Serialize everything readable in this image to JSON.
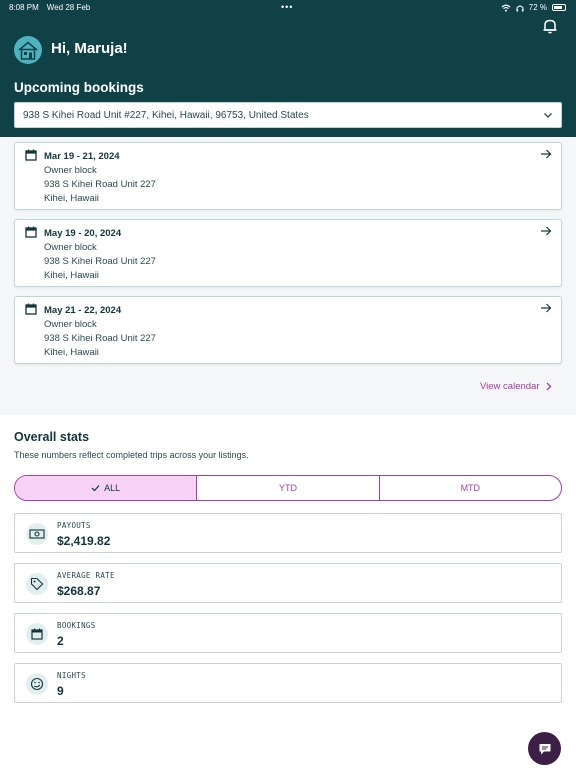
{
  "status_bar": {
    "time": "8:08 PM",
    "date": "Wed 28 Feb",
    "dots": "•••",
    "battery_pct": "72 %"
  },
  "header": {
    "greeting": "Hi, Maruja!"
  },
  "upcoming": {
    "title": "Upcoming bookings",
    "property_select": "938  S Kihei Road Unit #227, Kihei, Hawaii, 96753, United States",
    "bookings": [
      {
        "date": "Mar 19 - 21, 2024",
        "type": "Owner block",
        "address": "938  S Kihei Road Unit 227",
        "city": "Kihei, Hawaii"
      },
      {
        "date": "May 19 - 20, 2024",
        "type": "Owner block",
        "address": "938  S Kihei Road Unit 227",
        "city": "Kihei, Hawaii"
      },
      {
        "date": "May 21 - 22, 2024",
        "type": "Owner block",
        "address": "938  S Kihei Road Unit 227",
        "city": "Kihei, Hawaii"
      }
    ],
    "view_calendar": "View calendar"
  },
  "stats": {
    "title": "Overall stats",
    "description": "These numbers reflect completed trips across your listings.",
    "tabs": [
      "ALL",
      "YTD",
      "MTD"
    ],
    "active_tab": "ALL",
    "cards": [
      {
        "label": "PAYOUTS",
        "value": "$2,419.82",
        "icon": "money-icon"
      },
      {
        "label": "AVERAGE RATE",
        "value": "$268.87",
        "icon": "tag-icon"
      },
      {
        "label": "BOOKINGS",
        "value": "2",
        "icon": "calendar-icon"
      },
      {
        "label": "NIGHTS",
        "value": "9",
        "icon": "moon-icon"
      }
    ]
  },
  "colors": {
    "header_bg": "#0f4147",
    "accent": "#a23fa3",
    "active_tab_bg": "#f6d2f6",
    "chat_fab": "#3b1f45"
  }
}
